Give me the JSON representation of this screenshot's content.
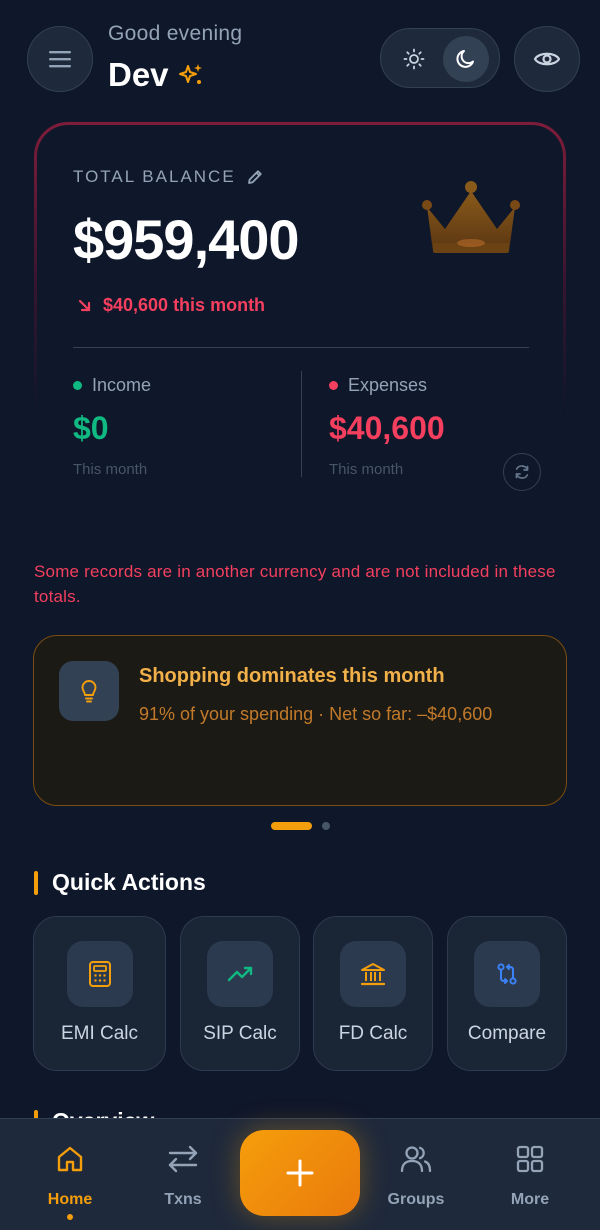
{
  "header": {
    "greeting": "Good evening",
    "username": "Dev",
    "menu_icon": "hamburger-menu-icon",
    "theme_options": [
      "sun-icon",
      "moon-icon"
    ],
    "theme_selected": "dark",
    "visibility_icon": "eye-icon"
  },
  "balance": {
    "label": "TOTAL BALANCE",
    "amount": "$959,400",
    "change": "$40,600 this month",
    "change_direction": "down",
    "income": {
      "label": "Income",
      "value": "$0",
      "sub": "This month",
      "color": "#10b981"
    },
    "expenses": {
      "label": "Expenses",
      "value": "$40,600",
      "sub": "This month",
      "color": "#f43f5e"
    }
  },
  "currency_warning": "Some records are in another currency and are not included in these totals.",
  "insight": {
    "title": "Shopping dominates this month",
    "body": "91% of your spending · Net so far: –$40,600",
    "icon": "lightbulb-icon",
    "page_index": 1,
    "page_count": 2
  },
  "quick_actions": {
    "title": "Quick Actions",
    "items": [
      {
        "label": "EMI Calc",
        "icon": "calculator-icon",
        "color": "#f59e0b"
      },
      {
        "label": "SIP Calc",
        "icon": "trending-up-icon",
        "color": "#10b981"
      },
      {
        "label": "FD Calc",
        "icon": "bank-icon",
        "color": "#f59e0b"
      },
      {
        "label": "Compare",
        "icon": "compare-arrows-icon",
        "color": "#3b82f6"
      }
    ]
  },
  "next_section": {
    "title": "Overview"
  },
  "nav": {
    "items": [
      {
        "label": "Home",
        "icon": "home-icon",
        "active": true
      },
      {
        "label": "Txns",
        "icon": "transfer-icon",
        "active": false
      },
      {
        "label": "Groups",
        "icon": "users-icon",
        "active": false
      },
      {
        "label": "More",
        "icon": "grid-icon",
        "active": false
      }
    ],
    "fab_icon": "plus-icon"
  },
  "colors": {
    "background": "#0f172a",
    "accent": "#f59e0b",
    "income": "#10b981",
    "expense": "#f43f5e"
  }
}
